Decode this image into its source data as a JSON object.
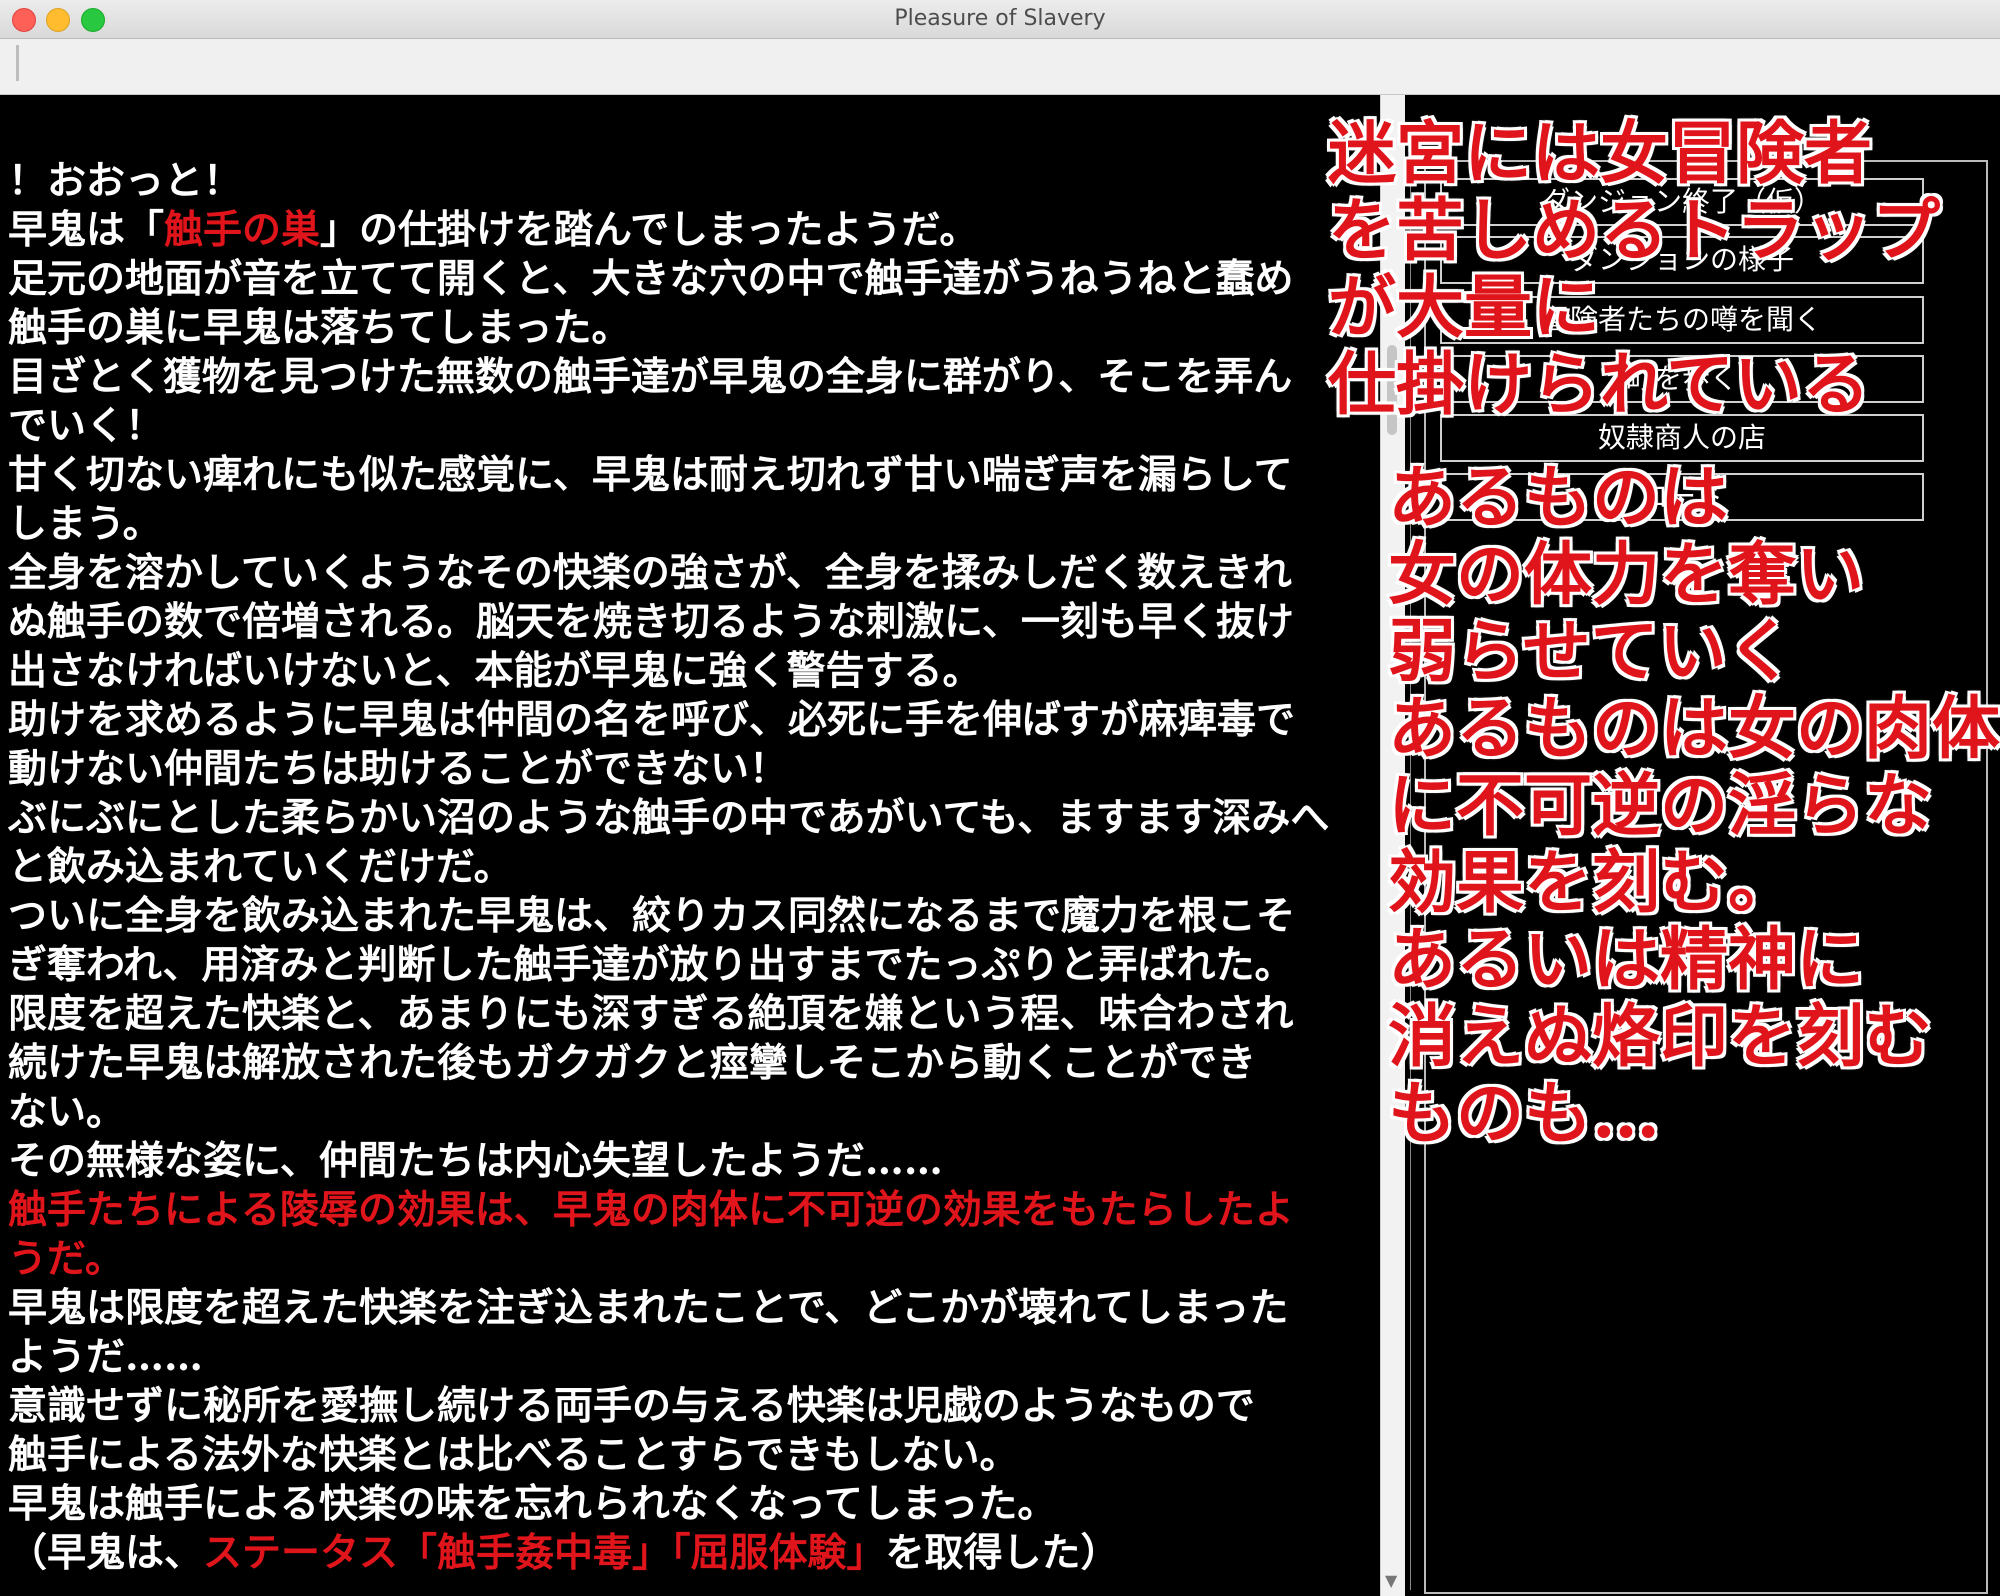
{
  "window": {
    "title": "Pleasure of Slavery"
  },
  "log": [
    [
      {
        "t": "！おおっと！"
      }
    ],
    [
      {
        "t": "早鬼は「"
      },
      {
        "t": "触手の巣",
        "c": "red"
      },
      {
        "t": "」の仕掛けを踏んでしまったようだ。"
      }
    ],
    [
      {
        "t": "足元の地面が音を立てて開くと、大きな穴の中で触手達がうねうねと蠢め"
      }
    ],
    [
      {
        "t": "触手の巣に早鬼は落ちてしまった。"
      }
    ],
    [
      {
        "t": "目ざとく獲物を見つけた無数の触手達が早鬼の全身に群がり、そこを弄ん"
      }
    ],
    [
      {
        "t": "でいく！"
      }
    ],
    [
      {
        "t": "甘く切ない痺れにも似た感覚に、早鬼は耐え切れず甘い喘ぎ声を漏らして"
      }
    ],
    [
      {
        "t": "しまう。"
      }
    ],
    [
      {
        "t": "全身を溶かしていくようなその快楽の強さが、全身を揉みしだく数えきれ"
      }
    ],
    [
      {
        "t": "ぬ触手の数で倍増される。脳天を焼き切るような刺激に、一刻も早く抜け"
      }
    ],
    [
      {
        "t": "出さなければいけないと、本能が早鬼に強く警告する。"
      }
    ],
    [
      {
        "t": "助けを求めるように早鬼は仲間の名を呼び、必死に手を伸ばすが麻痺毒で"
      }
    ],
    [
      {
        "t": "動けない仲間たちは助けることができない！"
      }
    ],
    [
      {
        "t": "ぶにぶにとした柔らかい沼のような触手の中であがいても、ますます深みへ"
      }
    ],
    [
      {
        "t": "と飲み込まれていくだけだ。"
      }
    ],
    [
      {
        "t": "ついに全身を飲み込まれた早鬼は、絞りカス同然になるまで魔力を根こそ"
      }
    ],
    [
      {
        "t": "ぎ奪われ、用済みと判断した触手達が放り出すまでたっぷりと弄ばれた。"
      }
    ],
    [
      {
        "t": "限度を超えた快楽と、あまりにも深すぎる絶頂を嫌という程、味合わされ"
      }
    ],
    [
      {
        "t": "続けた早鬼は解放された後もガクガクと痙攣しそこから動くことができ"
      }
    ],
    [
      {
        "t": "ない。"
      }
    ],
    [
      {
        "t": "その無様な姿に、仲間たちは内心失望したようだ……"
      }
    ],
    [
      {
        "t": "触手たちによる陵辱の効果は、早鬼の肉体に不可逆の効果をもたらしたよ",
        "c": "red"
      }
    ],
    [
      {
        "t": "うだ。",
        "c": "red"
      }
    ],
    [
      {
        "t": "早鬼は限度を超えた快楽を注ぎ込まれたことで、どこかが壊れてしまった"
      }
    ],
    [
      {
        "t": "ようだ……"
      }
    ],
    [
      {
        "t": "意識せずに秘所を愛撫し続ける両手の与える快楽は児戯のようなもので"
      }
    ],
    [
      {
        "t": "触手による法外な快楽とは比べることすらできもしない。"
      }
    ],
    [
      {
        "t": "早鬼は触手による快楽の味を忘れられなくなってしまった。"
      }
    ],
    [
      {
        "t": "（早鬼は、"
      },
      {
        "t": "ステータス「触手姦中毒」「屈服体験」",
        "c": "red"
      },
      {
        "t": "を取得した）"
      }
    ]
  ],
  "menu": [
    "ダンジョン終了（仮）",
    "ダンジョンの様子",
    "冒険者たちの噂を聞く",
    "町を歩く",
    "奴隷商人の店",
    "ロード"
  ],
  "overlay_a": [
    "迷宮には女冒険者",
    "を苦しめるトラップ",
    "が大量に",
    "仕掛けられている"
  ],
  "overlay_b": [
    "あるものは",
    "女の体力を奪い",
    "弱らせていく",
    "あるものは女の肉体",
    "に不可逆の淫らな",
    "効果を刻む。",
    "あるいは精神に",
    "消えぬ烙印を刻む",
    "ものも…"
  ]
}
